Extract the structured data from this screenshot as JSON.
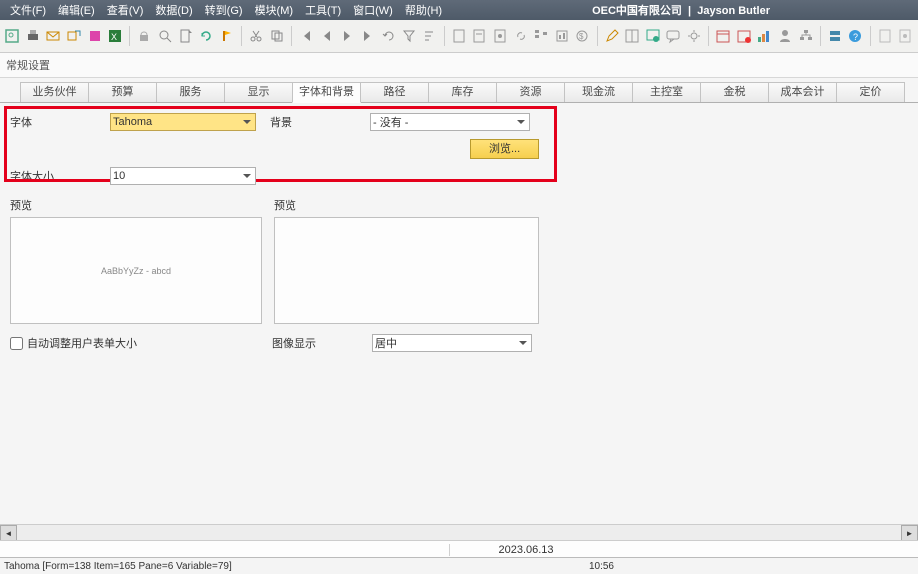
{
  "title_left": "OEC中国有限公司",
  "title_right": "Jayson Butler",
  "menus": [
    "文件(F)",
    "编辑(E)",
    "查看(V)",
    "数据(D)",
    "转到(G)",
    "模块(M)",
    "工具(T)",
    "窗口(W)",
    "帮助(H)"
  ],
  "subtitle": "常规设置",
  "tabs": [
    "业务伙伴",
    "预算",
    "服务",
    "显示",
    "字体和背景",
    "路径",
    "库存",
    "资源",
    "现金流",
    "主控室",
    "金税",
    "成本会计",
    "定价"
  ],
  "active_tab": 4,
  "labels": {
    "font": "字体",
    "font_size": "字体大小",
    "background": "背景",
    "browse": "浏览...",
    "preview": "预览",
    "auto_resize": "自动调整用户表单大小",
    "image_display": "图像显示"
  },
  "values": {
    "font": "Tahoma",
    "font_size": "10",
    "background": "- 没有 -",
    "image_display": "居中",
    "preview_sample": "AaBbYyZz - abcd"
  },
  "footer": {
    "date": "2023.06.13",
    "time": "10:56"
  },
  "statusbar": "Tahoma [Form=138 Item=165 Pane=6 Variable=79]",
  "colors": {
    "highlight_bg": "#ffe486",
    "button_bg": "#f9d96a"
  }
}
